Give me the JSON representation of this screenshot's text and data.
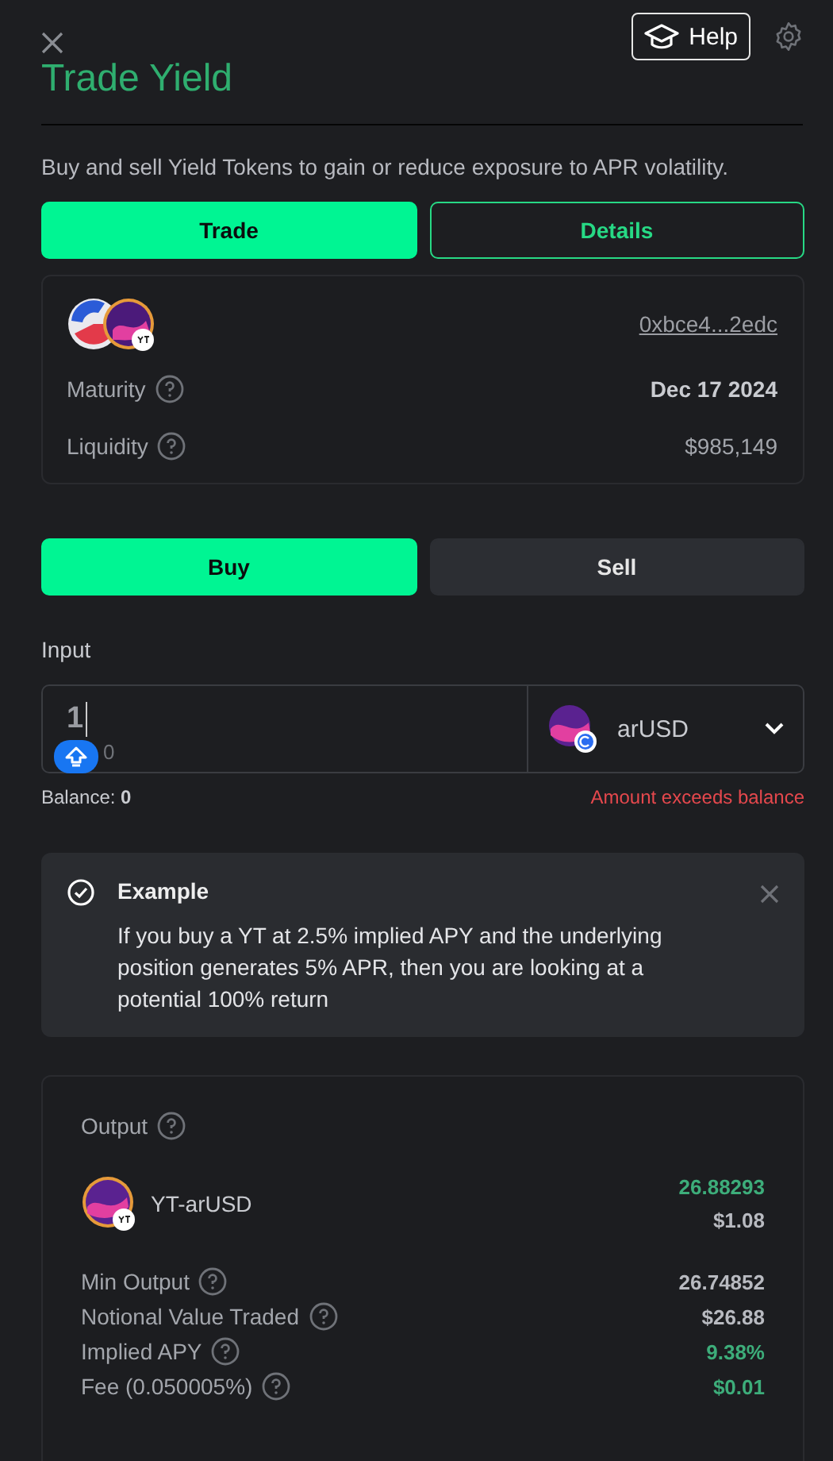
{
  "header": {
    "title": "Trade Yield",
    "help_label": "Help"
  },
  "description": "Buy and sell Yield Tokens to gain or reduce exposure to APR volatility.",
  "tabs": [
    {
      "label": "Trade",
      "selected": true
    },
    {
      "label": "Details",
      "selected": false
    }
  ],
  "market": {
    "address": "0xbce4...2edc",
    "rows": [
      {
        "label": "Maturity",
        "value": "Dec 17 2024",
        "bold": true
      },
      {
        "label": "Liquidity",
        "value": "$985,149",
        "bold": false
      }
    ]
  },
  "sides": [
    {
      "label": "Buy",
      "selected": true
    },
    {
      "label": "Sell",
      "selected": false
    }
  ],
  "input": {
    "label": "Input",
    "value": "1",
    "sub_value": "0",
    "token": "arUSD",
    "balance_label": "Balance:",
    "balance": "0",
    "error": "Amount exceeds balance"
  },
  "example": {
    "title": "Example",
    "text": "If you buy a YT at 2.5% implied APY and the underlying position generates 5% APR, then you are looking at a potential 100% return"
  },
  "output": {
    "label": "Output",
    "token": "YT-arUSD",
    "amount": "26.88293",
    "usd": "$1.08",
    "rows": [
      {
        "label": "Min Output",
        "value": "26.74852",
        "highlighted": false
      },
      {
        "label": "Notional Value Traded",
        "value": "$26.88",
        "highlighted": false
      },
      {
        "label": "Implied APY",
        "value": "9.38%",
        "highlighted": true
      },
      {
        "label": "Fee (0.050005%)",
        "value": "$0.01",
        "highlighted": true
      }
    ]
  }
}
